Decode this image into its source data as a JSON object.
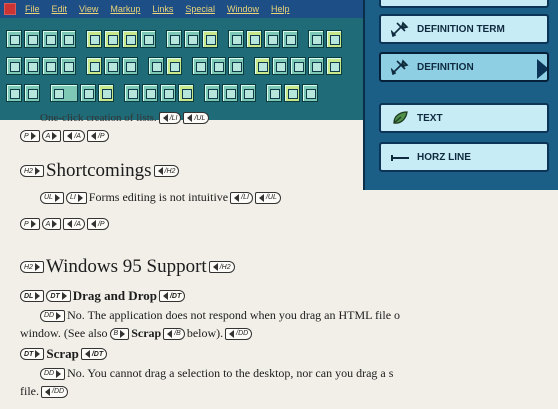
{
  "menubar": {
    "items": [
      "File",
      "Edit",
      "View",
      "Markup",
      "Links",
      "Special",
      "Window",
      "Help"
    ]
  },
  "palette": {
    "items": [
      {
        "label": "DEFINITION TERM",
        "icon": "tools-icon",
        "selected": false
      },
      {
        "label": "DEFINITION",
        "icon": "tools-icon",
        "selected": true
      },
      {
        "label": "TEXT",
        "icon": "leaf-icon",
        "selected": false
      },
      {
        "label": "HORZ LINE",
        "icon": "horizontal-line-icon",
        "selected": false
      }
    ]
  },
  "doc": {
    "cut_line": "One-click creation of lists.",
    "tags_row1": [
      "P",
      "A",
      "/A",
      "/P"
    ],
    "heading_shortcomings": "Shortcomings",
    "shortcomings_item": "Forms editing is not intuitive",
    "tags_row2": [
      "P",
      "A",
      "/A",
      "/P"
    ],
    "heading_win95": "Windows 95 Support",
    "dt1_title": "Drag and Drop",
    "dd1_text_a": "No. The application does not respond when you drag an HTML file o",
    "dd1_text_b": "window. (See also",
    "dd1_ref": "Scrap",
    "dd1_text_c": "below).",
    "dt2_title": "Scrap",
    "dd2_text_a": "No. You cannot drag a selection to the desktop, nor can you drag a s",
    "dd2_text_b": "file.",
    "tag_labels": {
      "h2": "H2",
      "h2c": "/H2",
      "ul": "UL",
      "li": "LI",
      "lic": "/LI",
      "ulc": "/UL",
      "dl": "DL",
      "dt": "DT",
      "dtc": "/DT",
      "dd": "DD",
      "ddc": "/DD",
      "b": "B",
      "bc": "/B",
      "lic2": "/LI"
    }
  }
}
